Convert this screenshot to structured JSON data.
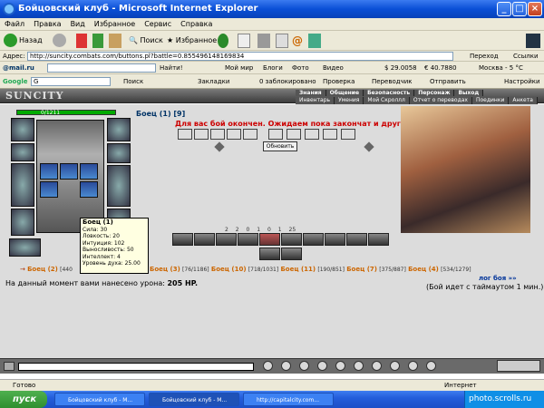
{
  "window": {
    "title": "Бойцовский клуб - Microsoft Internet Explorer"
  },
  "menu": [
    "Файл",
    "Правка",
    "Вид",
    "Избранное",
    "Сервис",
    "Справка"
  ],
  "toolbar": {
    "back": "Назад",
    "search": "Поиск",
    "favorites": "Избранное"
  },
  "address": {
    "label": "Адрес:",
    "url": "http://suncity.combats.com/buttons.pl?battle=0.855496148169834",
    "go": "Переход",
    "links": "Ссылки"
  },
  "mailbar": {
    "brand": "@mail.ru",
    "find": "Найти!",
    "my_world": "Мой мир",
    "blogs": "Блоги",
    "photo": "Фото",
    "video": "Видео",
    "usd": "29.0058",
    "eur": "40.7880",
    "weather": "Москва - 5 °C"
  },
  "googlebar": {
    "brand": "Google",
    "query": "G",
    "search": "Поиск",
    "bookmarks": "Закладки",
    "blocked": "0 заблокировано",
    "check": "Проверка",
    "translator": "Переводчик",
    "send": "Отправить",
    "settings": "Настройки"
  },
  "game": {
    "logo": "SUNCITY",
    "nav_top": [
      "Знания",
      "Общение",
      "Безопасность",
      "Персонаж",
      "Выход"
    ],
    "nav_bottom": [
      "Инвентарь",
      "Умения",
      "Мой Скроллл",
      "Отчет о переводах",
      "Поединки",
      "Анкета"
    ],
    "hp": "0/1211",
    "enemy_header": "Боец (1) [9]",
    "message": "Для вас бой окончен. Ожидаем пока закончат и другие игроки...",
    "refresh": "Обновить",
    "counters": [
      "2",
      "2",
      "0",
      "1",
      "0",
      "1",
      "25"
    ],
    "tooltip": {
      "title": "Боец (1)",
      "lines": [
        "Сила: 30",
        "Ловкость: 20",
        "Интуиция: 102",
        "Выносливость: 50",
        "Интеллект: 4",
        "Уровень духа: 25.00"
      ]
    },
    "fighters": [
      {
        "name": "Боец (2)",
        "hp": "[440"
      },
      {
        "name": "Боец (3)",
        "hp": "[76/1186]"
      },
      {
        "name": "Боец (10)",
        "hp": "[718/1031]"
      },
      {
        "name": "Боец (11)",
        "hp": "[190/851]"
      },
      {
        "name": "Боец (7)",
        "hp": "[375/887]"
      },
      {
        "name": "Боец (4)",
        "hp": "[534/1279]"
      }
    ],
    "log_link": "лог боя »»",
    "damage_text": "На данный момент вами нанесено урона:",
    "damage_value": "205 HP.",
    "timeout": "(Бой идет с таймаутом 1 мин.)"
  },
  "status": {
    "ready": "Готово",
    "zone": "Интернет"
  },
  "taskbar": {
    "start": "пуск",
    "tasks": [
      "Бойцовский клуб - M...",
      "Бойцовский клуб - M...",
      "http://capitalcity.com..."
    ],
    "tray": "photo.scrolls.ru"
  }
}
